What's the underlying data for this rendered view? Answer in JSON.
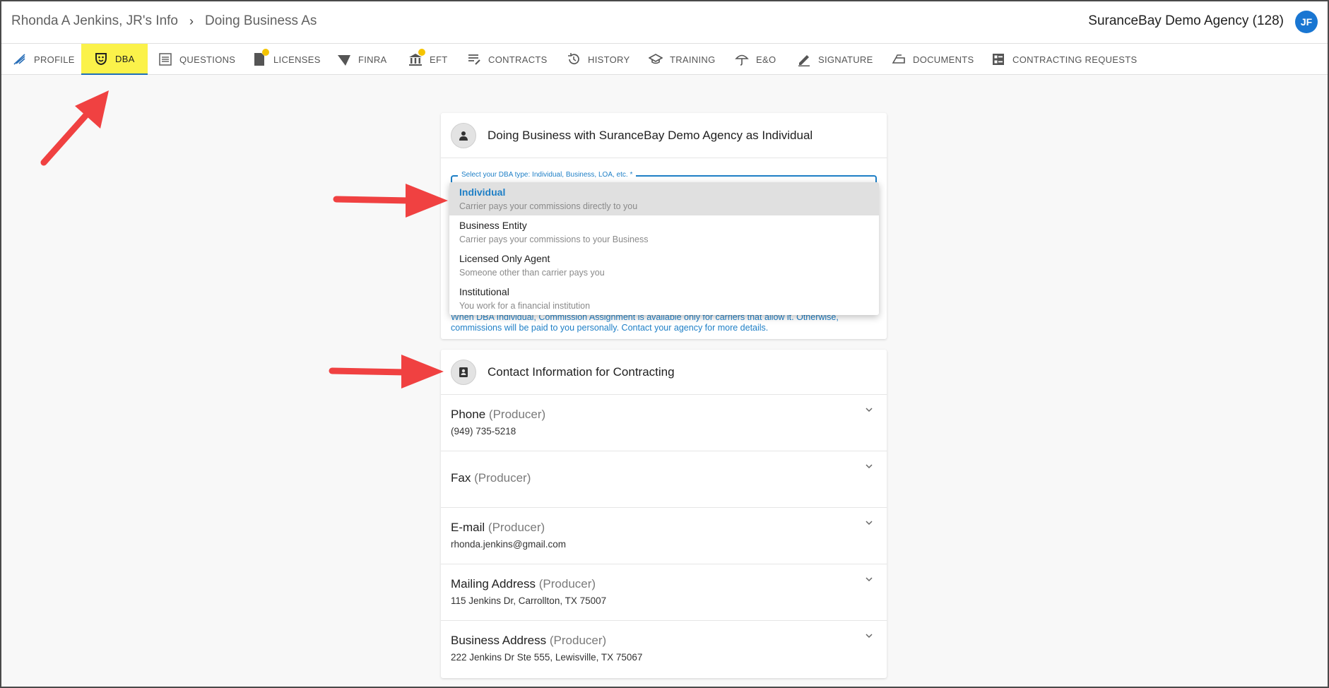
{
  "header": {
    "breadcrumb_parent": "Rhonda A Jenkins, JR's Info",
    "breadcrumb_sep": "›",
    "breadcrumb_current": "Doing Business As",
    "agency": "SuranceBay Demo Agency (128)",
    "avatar_initials": "JF",
    "avatar_color": "#1976d2"
  },
  "tabs": [
    {
      "label": "PROFILE",
      "icon": "profile-icon"
    },
    {
      "label": "DBA",
      "icon": "dba-mask-icon",
      "active": true
    },
    {
      "label": "QUESTIONS",
      "icon": "questions-list-icon"
    },
    {
      "label": "LICENSES",
      "icon": "license-icon",
      "badge": true
    },
    {
      "label": "FINRA",
      "icon": "finra-icon"
    },
    {
      "label": "EFT",
      "icon": "bank-icon",
      "badge": true
    },
    {
      "label": "CONTRACTS",
      "icon": "contracts-icon"
    },
    {
      "label": "HISTORY",
      "icon": "history-icon"
    },
    {
      "label": "TRAINING",
      "icon": "graduation-cap-icon"
    },
    {
      "label": "E&O",
      "icon": "umbrella-icon"
    },
    {
      "label": "SIGNATURE",
      "icon": "pen-icon"
    },
    {
      "label": "DOCUMENTS",
      "icon": "documents-icon"
    },
    {
      "label": "CONTRACTING REQUESTS",
      "icon": "requests-icon"
    }
  ],
  "dba_card": {
    "title": "Doing Business with SuranceBay Demo Agency as Individual",
    "select_label": "Select your DBA type: Individual, Business, LOA, etc. *",
    "help_line1": "When DBA Individual, Commission Assignment is available only for carriers that allow it. Otherwise,",
    "help_line2": "commissions will be paid to you personally. Contact your agency for more details."
  },
  "dba_options": [
    {
      "label": "Individual",
      "desc": "Carrier pays your commissions directly to you",
      "selected": true
    },
    {
      "label": "Business Entity",
      "desc": "Carrier pays your commissions to your Business"
    },
    {
      "label": "Licensed Only Agent",
      "desc": "Someone other than carrier pays you"
    },
    {
      "label": "Institutional",
      "desc": "You work for a financial institution"
    }
  ],
  "contact_card": {
    "title": "Contact Information for Contracting",
    "rows": [
      {
        "label": "Phone",
        "role": "(Producer)",
        "value": "(949) 735-5218"
      },
      {
        "label": "Fax",
        "role": "(Producer)",
        "value": ""
      },
      {
        "label": "E-mail",
        "role": "(Producer)",
        "value": "rhonda.jenkins@gmail.com"
      },
      {
        "label": "Mailing Address",
        "role": "(Producer)",
        "value": "115 Jenkins Dr, Carrollton, TX 75007"
      },
      {
        "label": "Business Address",
        "role": "(Producer)",
        "value": "222 Jenkins Dr Ste 555, Lewisville, TX 75067"
      }
    ]
  },
  "colors": {
    "accent": "#1e7fc6",
    "active_tab_bg": "#fbf24a",
    "annotation_arrow": "#f04141"
  }
}
